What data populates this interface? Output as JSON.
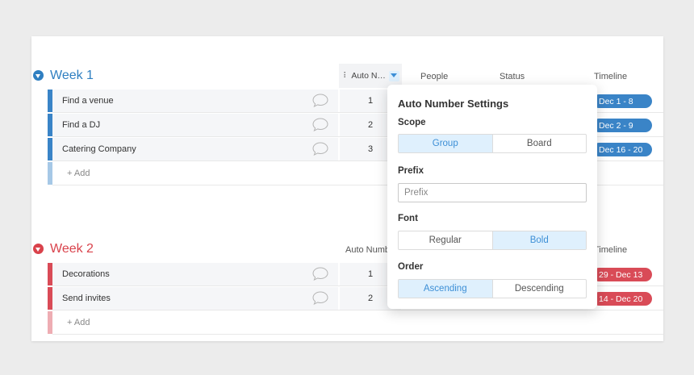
{
  "colors": {
    "week1_accent": "#2f7fc1",
    "week1_bar": "#3a84c7",
    "week1_add": "#a6c8e6",
    "week2_accent": "#d9424b",
    "week2_bar": "#d94b57",
    "week2_add": "#eeadb3",
    "toggle_active": "#dff0fd",
    "toggle_active_text": "#3d8fd6"
  },
  "groups": [
    {
      "title": "Week 1",
      "columns": {
        "auto": "Auto N…",
        "people": "People",
        "status": "Status",
        "timeline": "Timeline"
      },
      "items": [
        {
          "name": "Find a venue",
          "num": "1",
          "timeline": "Dec 1 - 8"
        },
        {
          "name": "Find a DJ",
          "num": "2",
          "timeline": "Dec 2 - 9"
        },
        {
          "name": "Catering Company",
          "num": "3",
          "timeline": "Dec 16 - 20"
        }
      ],
      "add_label": "+ Add"
    },
    {
      "title": "Week 2",
      "columns": {
        "auto": "Auto Numb",
        "timeline": "Timeline"
      },
      "items": [
        {
          "name": "Decorations",
          "num": "1",
          "timeline": "29 - Dec 13"
        },
        {
          "name": "Send invites",
          "num": "2",
          "timeline": "14 - Dec 20"
        }
      ],
      "add_label": "+ Add"
    }
  ],
  "popup": {
    "title": "Auto Number Settings",
    "scope": {
      "label": "Scope",
      "options": [
        "Group",
        "Board"
      ],
      "selected": "Group"
    },
    "prefix": {
      "label": "Prefix",
      "placeholder": "Prefix",
      "value": ""
    },
    "font": {
      "label": "Font",
      "options": [
        "Regular",
        "Bold"
      ],
      "selected": "Bold"
    },
    "order": {
      "label": "Order",
      "options": [
        "Ascending",
        "Descending"
      ],
      "selected": "Ascending"
    }
  }
}
